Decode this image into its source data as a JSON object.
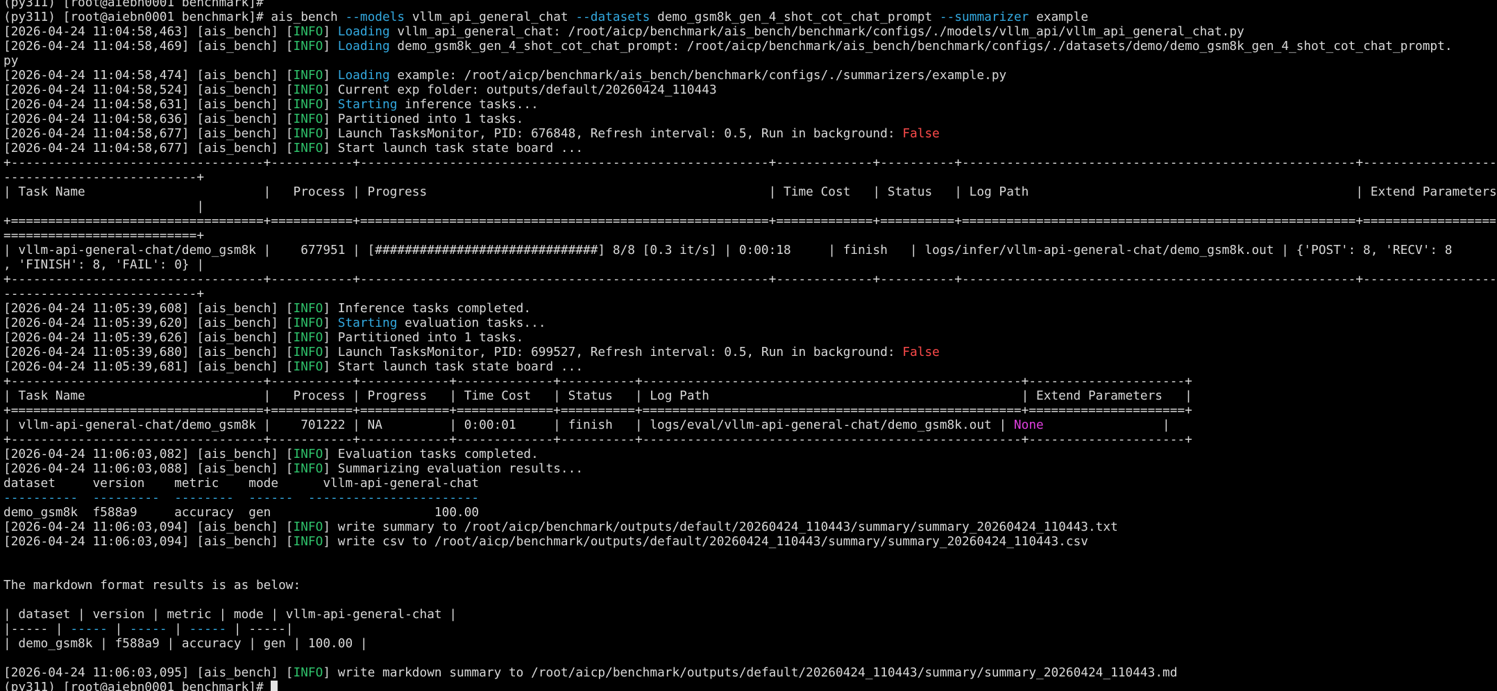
{
  "colors": {
    "text": "#d9d9d9",
    "info": "#2fc26b",
    "keyword": "#33a9e0",
    "false": "#ff4b4b",
    "none": "#e03fe0",
    "background": "#000000"
  },
  "lines": [
    [
      {
        "t": "(py311) [root@aiebn0001 benchmark]#"
      }
    ],
    [
      {
        "t": "(py311) [root@aiebn0001 benchmark]# ais_bench "
      },
      {
        "t": "--models",
        "c": "keyword"
      },
      {
        "t": " vllm_api_general_chat "
      },
      {
        "t": "--datasets",
        "c": "keyword"
      },
      {
        "t": " demo_gsm8k_gen_4_shot_cot_chat_prompt "
      },
      {
        "t": "--summarizer",
        "c": "keyword"
      },
      {
        "t": " example"
      }
    ],
    [
      {
        "t": "[2026-04-24 11:04:58,463] [ais_bench] ["
      },
      {
        "t": "INFO",
        "c": "info"
      },
      {
        "t": "] "
      },
      {
        "t": "Loading",
        "c": "keyword"
      },
      {
        "t": " vllm_api_general_chat: /root/aicp/benchmark/ais_bench/benchmark/configs/./models/vllm_api/vllm_api_general_chat.py"
      }
    ],
    [
      {
        "t": "[2026-04-24 11:04:58,469] [ais_bench] ["
      },
      {
        "t": "INFO",
        "c": "info"
      },
      {
        "t": "] "
      },
      {
        "t": "Loading",
        "c": "keyword"
      },
      {
        "t": " demo_gsm8k_gen_4_shot_cot_chat_prompt: /root/aicp/benchmark/ais_bench/benchmark/configs/./datasets/demo/demo_gsm8k_gen_4_shot_cot_chat_prompt."
      }
    ],
    [
      {
        "t": "py"
      }
    ],
    [
      {
        "t": "[2026-04-24 11:04:58,474] [ais_bench] ["
      },
      {
        "t": "INFO",
        "c": "info"
      },
      {
        "t": "] "
      },
      {
        "t": "Loading",
        "c": "keyword"
      },
      {
        "t": " example: /root/aicp/benchmark/ais_bench/benchmark/configs/./summarizers/example.py"
      }
    ],
    [
      {
        "t": "[2026-04-24 11:04:58,524] [ais_bench] ["
      },
      {
        "t": "INFO",
        "c": "info"
      },
      {
        "t": "] Current exp folder: outputs/default/20260424_110443"
      }
    ],
    [
      {
        "t": "[2026-04-24 11:04:58,631] [ais_bench] ["
      },
      {
        "t": "INFO",
        "c": "info"
      },
      {
        "t": "] "
      },
      {
        "t": "Starting",
        "c": "keyword"
      },
      {
        "t": " inference tasks..."
      }
    ],
    [
      {
        "t": "[2026-04-24 11:04:58,636] [ais_bench] ["
      },
      {
        "t": "INFO",
        "c": "info"
      },
      {
        "t": "] Partitioned into 1 tasks."
      }
    ],
    [
      {
        "t": "[2026-04-24 11:04:58,677] [ais_bench] ["
      },
      {
        "t": "INFO",
        "c": "info"
      },
      {
        "t": "] Launch TasksMonitor, PID: 676848, Refresh interval: 0.5, Run in background: "
      },
      {
        "t": "False",
        "c": "false"
      }
    ],
    [
      {
        "t": "[2026-04-24 11:04:58,677] [ais_bench] ["
      },
      {
        "t": "INFO",
        "c": "info"
      },
      {
        "t": "] Start launch task state board ..."
      }
    ],
    [
      {
        "t": "+----------------------------------+-----------+-------------------------------------------------------+-------------+----------+-----------------------------------------------------+--------------------"
      }
    ],
    [
      {
        "t": "--------------------------+"
      }
    ],
    [
      {
        "t": "| Task Name                        |   Process | Progress                                              | Time Cost   | Status   | Log Path                                            | Extend Parameters"
      }
    ],
    [
      {
        "t": "                          |"
      }
    ],
    [
      {
        "t": "+==================================+===========+=======================================================+=============+==========+=====================================================+===================="
      }
    ],
    [
      {
        "t": "==========================+"
      }
    ],
    [
      {
        "t": "| vllm-api-general-chat/demo_gsm8k |    677951 | [##############################] 8/8 [0.3 it/s] | 0:00:18     | finish   | logs/infer/vllm-api-general-chat/demo_gsm8k.out | {'POST': 8, 'RECV': 8"
      }
    ],
    [
      {
        "t": ", 'FINISH': 8, 'FAIL': 0} |"
      }
    ],
    [
      {
        "t": "+----------------------------------+-----------+-------------------------------------------------------+-------------+----------+-----------------------------------------------------+--------------------"
      }
    ],
    [
      {
        "t": "--------------------------+"
      }
    ],
    [
      {
        "t": "[2026-04-24 11:05:39,608] [ais_bench] ["
      },
      {
        "t": "INFO",
        "c": "info"
      },
      {
        "t": "] Inference tasks completed."
      }
    ],
    [
      {
        "t": "[2026-04-24 11:05:39,620] [ais_bench] ["
      },
      {
        "t": "INFO",
        "c": "info"
      },
      {
        "t": "] "
      },
      {
        "t": "Starting",
        "c": "keyword"
      },
      {
        "t": " evaluation tasks..."
      }
    ],
    [
      {
        "t": "[2026-04-24 11:05:39,626] [ais_bench] ["
      },
      {
        "t": "INFO",
        "c": "info"
      },
      {
        "t": "] Partitioned into 1 tasks."
      }
    ],
    [
      {
        "t": "[2026-04-24 11:05:39,680] [ais_bench] ["
      },
      {
        "t": "INFO",
        "c": "info"
      },
      {
        "t": "] Launch TasksMonitor, PID: 699527, Refresh interval: 0.5, Run in background: "
      },
      {
        "t": "False",
        "c": "false"
      }
    ],
    [
      {
        "t": "[2026-04-24 11:05:39,681] [ais_bench] ["
      },
      {
        "t": "INFO",
        "c": "info"
      },
      {
        "t": "] Start launch task state board ..."
      }
    ],
    [
      {
        "t": "+----------------------------------+-----------+------------+-------------+----------+---------------------------------------------------+---------------------+"
      }
    ],
    [
      {
        "t": "| Task Name                        |   Process | Progress   | Time Cost   | Status   | Log Path                                          | Extend Parameters   |"
      }
    ],
    [
      {
        "t": "+==================================+===========+============+=============+==========+===================================================+=====================+"
      }
    ],
    [
      {
        "t": "| vllm-api-general-chat/demo_gsm8k |    701222 | NA         | 0:00:01     | finish   | logs/eval/vllm-api-general-chat/demo_gsm8k.out | "
      },
      {
        "t": "None",
        "c": "none"
      },
      {
        "t": "                |"
      }
    ],
    [
      {
        "t": "+----------------------------------+-----------+------------+-------------+----------+---------------------------------------------------+---------------------+"
      }
    ],
    [
      {
        "t": "[2026-04-24 11:06:03,082] [ais_bench] ["
      },
      {
        "t": "INFO",
        "c": "info"
      },
      {
        "t": "] Evaluation tasks completed."
      }
    ],
    [
      {
        "t": "[2026-04-24 11:06:03,088] [ais_bench] ["
      },
      {
        "t": "INFO",
        "c": "info"
      },
      {
        "t": "] Summarizing evaluation results..."
      }
    ],
    [
      {
        "t": "dataset     version    metric    mode      vllm-api-general-chat"
      }
    ],
    [
      {
        "t": "----------  ---------  --------  ------  -----------------------",
        "c": "keyword"
      }
    ],
    [
      {
        "t": "demo_gsm8k  f588a9     accuracy  gen                      100.00"
      }
    ],
    [
      {
        "t": "[2026-04-24 11:06:03,094] [ais_bench] ["
      },
      {
        "t": "INFO",
        "c": "info"
      },
      {
        "t": "] write summary to /root/aicp/benchmark/outputs/default/20260424_110443/summary/summary_20260424_110443.txt"
      }
    ],
    [
      {
        "t": "[2026-04-24 11:06:03,094] [ais_bench] ["
      },
      {
        "t": "INFO",
        "c": "info"
      },
      {
        "t": "] write csv to /root/aicp/benchmark/outputs/default/20260424_110443/summary/summary_20260424_110443.csv"
      }
    ],
    [
      {
        "t": ""
      }
    ],
    [
      {
        "t": ""
      }
    ],
    [
      {
        "t": "The markdown format results is as below:"
      }
    ],
    [
      {
        "t": ""
      }
    ],
    [
      {
        "t": "| dataset | version | metric | mode | vllm-api-general-chat |"
      }
    ],
    [
      {
        "t": "|----- | "
      },
      {
        "t": "-----",
        "c": "keyword"
      },
      {
        "t": " | "
      },
      {
        "t": "-----",
        "c": "keyword"
      },
      {
        "t": " | "
      },
      {
        "t": "-----",
        "c": "keyword"
      },
      {
        "t": " | -----|"
      }
    ],
    [
      {
        "t": "| demo_gsm8k | f588a9 | accuracy | gen | 100.00 |"
      }
    ],
    [
      {
        "t": ""
      }
    ],
    [
      {
        "t": "[2026-04-24 11:06:03,095] [ais_bench] ["
      },
      {
        "t": "INFO",
        "c": "info"
      },
      {
        "t": "] write markdown summary to /root/aicp/benchmark/outputs/default/20260424_110443/summary/summary_20260424_110443.md"
      }
    ],
    [
      {
        "t": "(py311) [root@aiebn0001 benchmark]# "
      },
      {
        "t": "",
        "c": "cursor"
      }
    ]
  ]
}
